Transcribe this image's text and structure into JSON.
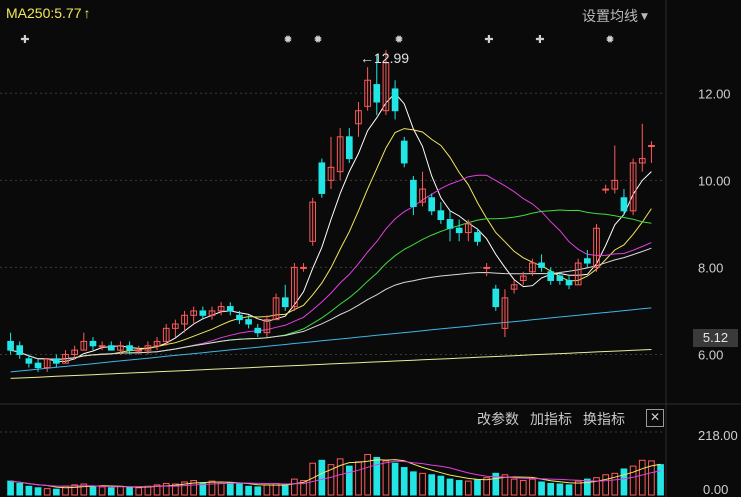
{
  "header": {
    "ma_label": "MA250:5.77",
    "ma_arrow": "↑",
    "settings_label": "设置均线",
    "settings_caret": "▼"
  },
  "price_axis": {
    "ticks": [
      "12.00",
      "10.00",
      "8.00",
      "6.00"
    ],
    "current_price": "5.12"
  },
  "annotations": {
    "high_label": "←12.99"
  },
  "volume_panel": {
    "toolbar": [
      "改参数",
      "加指标",
      "换指标"
    ],
    "close_icon": "close-icon",
    "ticks": [
      "218.00",
      "0.00"
    ]
  },
  "colors": {
    "up": "#ff5a5a",
    "down": "#22e5e5",
    "ma_white": "#ffffff",
    "ma_yellow": "#f2e85c",
    "ma_magenta": "#e040e0",
    "ma_green": "#3fdc3f",
    "ma_gray": "#d8d8d8",
    "ma_cyan": "#3fb6e8",
    "ma_long": "#ecec9a"
  },
  "chart_data": {
    "type": "candlestick",
    "y_range": [
      5.0,
      13.5
    ],
    "candles": [
      {
        "o": 6.3,
        "h": 6.5,
        "l": 6.0,
        "c": 6.1
      },
      {
        "o": 6.2,
        "h": 6.3,
        "l": 5.9,
        "c": 6.0
      },
      {
        "o": 5.9,
        "h": 6.0,
        "l": 5.7,
        "c": 5.8
      },
      {
        "o": 5.8,
        "h": 5.9,
        "l": 5.6,
        "c": 5.7
      },
      {
        "o": 5.7,
        "h": 5.9,
        "l": 5.6,
        "c": 5.9
      },
      {
        "o": 5.9,
        "h": 6.0,
        "l": 5.7,
        "c": 5.8
      },
      {
        "o": 5.8,
        "h": 6.1,
        "l": 5.8,
        "c": 6.0
      },
      {
        "o": 6.0,
        "h": 6.2,
        "l": 5.9,
        "c": 6.1
      },
      {
        "o": 6.1,
        "h": 6.5,
        "l": 6.1,
        "c": 6.3
      },
      {
        "o": 6.3,
        "h": 6.4,
        "l": 6.1,
        "c": 6.2
      },
      {
        "o": 6.2,
        "h": 6.3,
        "l": 6.1,
        "c": 6.2
      },
      {
        "o": 6.2,
        "h": 6.3,
        "l": 6.1,
        "c": 6.1
      },
      {
        "o": 6.1,
        "h": 6.3,
        "l": 6.0,
        "c": 6.2
      },
      {
        "o": 6.2,
        "h": 6.3,
        "l": 6.0,
        "c": 6.1
      },
      {
        "o": 6.1,
        "h": 6.2,
        "l": 6.0,
        "c": 6.1
      },
      {
        "o": 6.1,
        "h": 6.3,
        "l": 6.0,
        "c": 6.2
      },
      {
        "o": 6.2,
        "h": 6.4,
        "l": 6.1,
        "c": 6.3
      },
      {
        "o": 6.3,
        "h": 6.7,
        "l": 6.2,
        "c": 6.6
      },
      {
        "o": 6.6,
        "h": 6.8,
        "l": 6.4,
        "c": 6.7
      },
      {
        "o": 6.7,
        "h": 7.0,
        "l": 6.5,
        "c": 6.9
      },
      {
        "o": 6.9,
        "h": 7.1,
        "l": 6.7,
        "c": 7.0
      },
      {
        "o": 7.0,
        "h": 7.1,
        "l": 6.8,
        "c": 6.9
      },
      {
        "o": 6.9,
        "h": 7.1,
        "l": 6.8,
        "c": 7.0
      },
      {
        "o": 7.0,
        "h": 7.2,
        "l": 6.9,
        "c": 7.1
      },
      {
        "o": 7.1,
        "h": 7.2,
        "l": 6.9,
        "c": 7.0
      },
      {
        "o": 6.9,
        "h": 7.0,
        "l": 6.7,
        "c": 6.8
      },
      {
        "o": 6.8,
        "h": 6.9,
        "l": 6.6,
        "c": 6.7
      },
      {
        "o": 6.6,
        "h": 6.7,
        "l": 6.4,
        "c": 6.5
      },
      {
        "o": 6.5,
        "h": 6.9,
        "l": 6.4,
        "c": 6.8
      },
      {
        "o": 6.8,
        "h": 7.4,
        "l": 6.8,
        "c": 7.3
      },
      {
        "o": 7.3,
        "h": 7.6,
        "l": 7.0,
        "c": 7.1
      },
      {
        "o": 7.1,
        "h": 8.1,
        "l": 7.0,
        "c": 8.0
      },
      {
        "o": 8.0,
        "h": 8.1,
        "l": 7.9,
        "c": 8.0
      },
      {
        "o": 8.6,
        "h": 9.6,
        "l": 8.5,
        "c": 9.5
      },
      {
        "o": 10.4,
        "h": 10.5,
        "l": 9.6,
        "c": 9.7
      },
      {
        "o": 10.0,
        "h": 11.0,
        "l": 9.8,
        "c": 10.3
      },
      {
        "o": 10.2,
        "h": 11.2,
        "l": 10.0,
        "c": 11.0
      },
      {
        "o": 11.0,
        "h": 11.2,
        "l": 10.4,
        "c": 10.5
      },
      {
        "o": 11.3,
        "h": 11.8,
        "l": 11.0,
        "c": 11.6
      },
      {
        "o": 11.7,
        "h": 12.6,
        "l": 11.6,
        "c": 12.3
      },
      {
        "o": 12.2,
        "h": 12.9,
        "l": 11.5,
        "c": 11.8
      },
      {
        "o": 11.6,
        "h": 12.99,
        "l": 11.5,
        "c": 12.7
      },
      {
        "o": 12.1,
        "h": 12.3,
        "l": 11.4,
        "c": 11.6
      },
      {
        "o": 10.9,
        "h": 11.0,
        "l": 10.3,
        "c": 10.4
      },
      {
        "o": 10.0,
        "h": 10.1,
        "l": 9.2,
        "c": 9.4
      },
      {
        "o": 9.5,
        "h": 10.2,
        "l": 9.4,
        "c": 9.8
      },
      {
        "o": 9.6,
        "h": 9.7,
        "l": 9.2,
        "c": 9.3
      },
      {
        "o": 9.3,
        "h": 9.5,
        "l": 9.0,
        "c": 9.1
      },
      {
        "o": 9.1,
        "h": 9.3,
        "l": 8.6,
        "c": 8.9
      },
      {
        "o": 8.9,
        "h": 9.1,
        "l": 8.6,
        "c": 8.8
      },
      {
        "o": 8.8,
        "h": 9.1,
        "l": 8.6,
        "c": 9.0
      },
      {
        "o": 8.8,
        "h": 8.9,
        "l": 8.5,
        "c": 8.6
      },
      {
        "o": 8.0,
        "h": 8.1,
        "l": 7.8,
        "c": 8.0
      },
      {
        "o": 7.5,
        "h": 7.6,
        "l": 7.0,
        "c": 7.1
      },
      {
        "o": 6.6,
        "h": 7.5,
        "l": 6.4,
        "c": 7.3
      },
      {
        "o": 7.5,
        "h": 7.7,
        "l": 7.4,
        "c": 7.6
      },
      {
        "o": 7.7,
        "h": 7.9,
        "l": 7.6,
        "c": 7.8
      },
      {
        "o": 7.9,
        "h": 8.2,
        "l": 7.8,
        "c": 8.1
      },
      {
        "o": 8.1,
        "h": 8.3,
        "l": 7.9,
        "c": 8.0
      },
      {
        "o": 7.9,
        "h": 8.0,
        "l": 7.6,
        "c": 7.7
      },
      {
        "o": 7.8,
        "h": 7.9,
        "l": 7.6,
        "c": 7.7
      },
      {
        "o": 7.7,
        "h": 7.8,
        "l": 7.5,
        "c": 7.6
      },
      {
        "o": 7.6,
        "h": 8.2,
        "l": 7.6,
        "c": 8.1
      },
      {
        "o": 8.2,
        "h": 8.4,
        "l": 8.0,
        "c": 8.1
      },
      {
        "o": 8.0,
        "h": 9.0,
        "l": 7.9,
        "c": 8.9
      },
      {
        "o": 9.8,
        "h": 9.9,
        "l": 9.7,
        "c": 9.8
      },
      {
        "o": 9.8,
        "h": 10.8,
        "l": 9.7,
        "c": 10.0
      },
      {
        "o": 9.6,
        "h": 9.8,
        "l": 9.2,
        "c": 9.3
      },
      {
        "o": 9.3,
        "h": 10.5,
        "l": 9.2,
        "c": 10.4
      },
      {
        "o": 10.4,
        "h": 11.3,
        "l": 10.2,
        "c": 10.5
      },
      {
        "o": 10.8,
        "h": 10.9,
        "l": 10.4,
        "c": 10.8
      }
    ],
    "volume": [
      48,
      40,
      30,
      25,
      22,
      20,
      30,
      35,
      38,
      30,
      28,
      25,
      30,
      28,
      25,
      30,
      35,
      40,
      38,
      45,
      50,
      42,
      48,
      40,
      42,
      38,
      30,
      28,
      35,
      40,
      38,
      55,
      50,
      110,
      120,
      105,
      125,
      100,
      115,
      140,
      130,
      118,
      110,
      95,
      80,
      75,
      70,
      65,
      55,
      50,
      48,
      52,
      60,
      75,
      70,
      55,
      50,
      55,
      45,
      40,
      38,
      35,
      48,
      55,
      60,
      70,
      75,
      90,
      100,
      120,
      118,
      105
    ]
  }
}
